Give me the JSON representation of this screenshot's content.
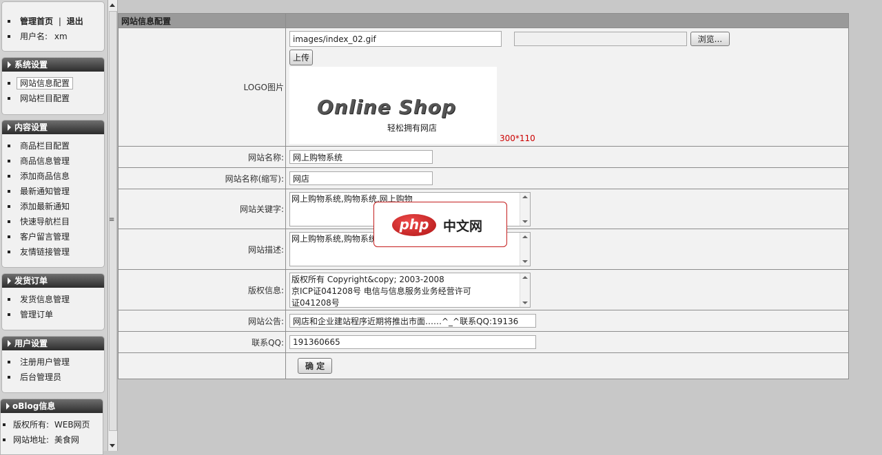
{
  "sidebar": {
    "top": {
      "home_label": "管理首页",
      "separator": "|",
      "logout_label": "退出",
      "username_label": "用户名:",
      "username_value": "xm"
    },
    "sections": [
      {
        "title": "系统设置",
        "items": [
          "网站信息配置",
          "网站栏目配置"
        ]
      },
      {
        "title": "内容设置",
        "items": [
          "商品栏目配置",
          "商品信息管理",
          "添加商品信息",
          "最新通知管理",
          "添加最新通知",
          "快速导航栏目",
          "客户留言管理",
          "友情链接管理"
        ]
      },
      {
        "title": "发货订单",
        "items": [
          "发货信息管理",
          "管理订单"
        ]
      },
      {
        "title": "用户设置",
        "items": [
          "注册用户管理",
          "后台管理员"
        ]
      }
    ],
    "oblog": {
      "title": "oBlog信息",
      "copyright_label": "版权所有:",
      "copyright_value": "WEB网页",
      "address_label": "网站地址:",
      "address_value": "美食网"
    }
  },
  "form": {
    "header_title": "网站信息配置",
    "logo": {
      "label": "LOGO图片",
      "path_value": "images/index_02.gif",
      "file_value": "",
      "browse_button": "浏览...",
      "upload_button": "上传",
      "size_hint": "300*110",
      "size_hint_color": "#cc0000",
      "preview_title": "Online Shop",
      "preview_subtitle": "轻松拥有网店"
    },
    "site_name": {
      "label": "网站名称:",
      "value": "网上购物系统"
    },
    "site_short_name": {
      "label": "网站名称(缩写):",
      "value": "网店"
    },
    "keywords": {
      "label": "网站关键字:",
      "value": "网上购物系统,购物系统,网上购物"
    },
    "description": {
      "label": "网站描述:",
      "value": "网上购物系统,购物系统"
    },
    "copyright": {
      "label": "版权信息:",
      "line1": "版权所有  Copyright&copy; 2003-2008",
      "line2": "京ICP证041208号        电信与信息服务业务经营许可",
      "line3": "证041208号"
    },
    "notice": {
      "label": "网站公告:",
      "value": "网店和企业建站程序近期将推出市面……^_^联系QQ:19136"
    },
    "qq": {
      "label": "联系QQ:",
      "value": "191360665"
    },
    "submit_label": "确 定"
  },
  "watermark": {
    "logo_text": "php",
    "text": "中文网",
    "accent": "#c41c1c"
  }
}
